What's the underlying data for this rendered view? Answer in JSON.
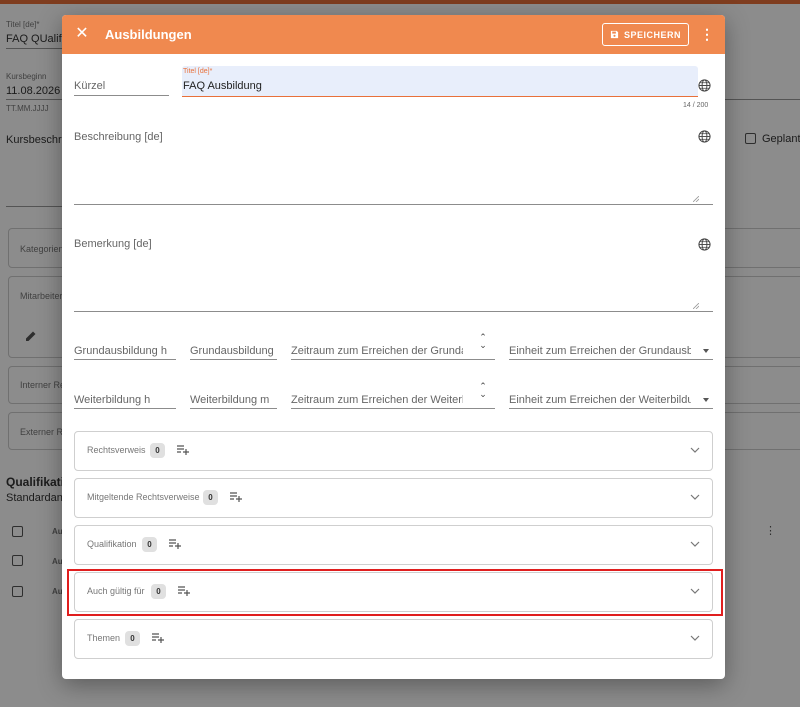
{
  "background": {
    "title_label": "Titel [de]*",
    "title_value": "FAQ QUalifi",
    "kursbeginn_label": "Kursbeginn",
    "kursbeginn_value": "11.08.2026",
    "date_hint": "TT.MM.JJJJ",
    "kursbeschreibung": "Kursbeschre",
    "geplante": "Geplante",
    "kategorien": "Kategorien",
    "mitarbeiter": "Mitarbeiter",
    "interner": "Interner Re",
    "externer": "Externer Re",
    "qualifikation_heading": "Qualifikatio",
    "standardansicht": "Standardansi",
    "col_header": "Au",
    "row1": "Au",
    "row2": "Au"
  },
  "dialog": {
    "title": "Ausbildungen",
    "save_label": "SPEICHERN",
    "fields": {
      "kuerzel": "Kürzel",
      "title_label": "Titel [de]*",
      "title_value": "FAQ Ausbildung",
      "title_counter": "14 / 200",
      "beschreibung": "Beschreibung [de]",
      "bemerkung": "Bemerkung [de]",
      "grundausbildung_h": "Grundausbildung h",
      "grundausbildung_m": "Grundausbildung m",
      "zeitraum_grund": "Zeitraum zum Erreichen der Grundausbildung",
      "einheit_grund": "Einheit zum Erreichen der Grundausbildung",
      "weiterbildung_h": "Weiterbildung h",
      "weiterbildung_m": "Weiterbildung m",
      "zeitraum_weiter": "Zeitraum zum Erreichen der Weiterbildung",
      "einheit_weiter": "Einheit zum Erreichen der Weiterbildung"
    },
    "panels": [
      {
        "title": "Rechtsverweis",
        "count": "0"
      },
      {
        "title": "Mitgeltende Rechtsverweise",
        "count": "0"
      },
      {
        "title": "Qualifikation",
        "count": "0"
      },
      {
        "title": "Auch gültig für",
        "count": "0"
      },
      {
        "title": "Themen",
        "count": "0"
      }
    ]
  },
  "colors": {
    "accent": "#f0894f",
    "highlight": "#e01e1e"
  }
}
